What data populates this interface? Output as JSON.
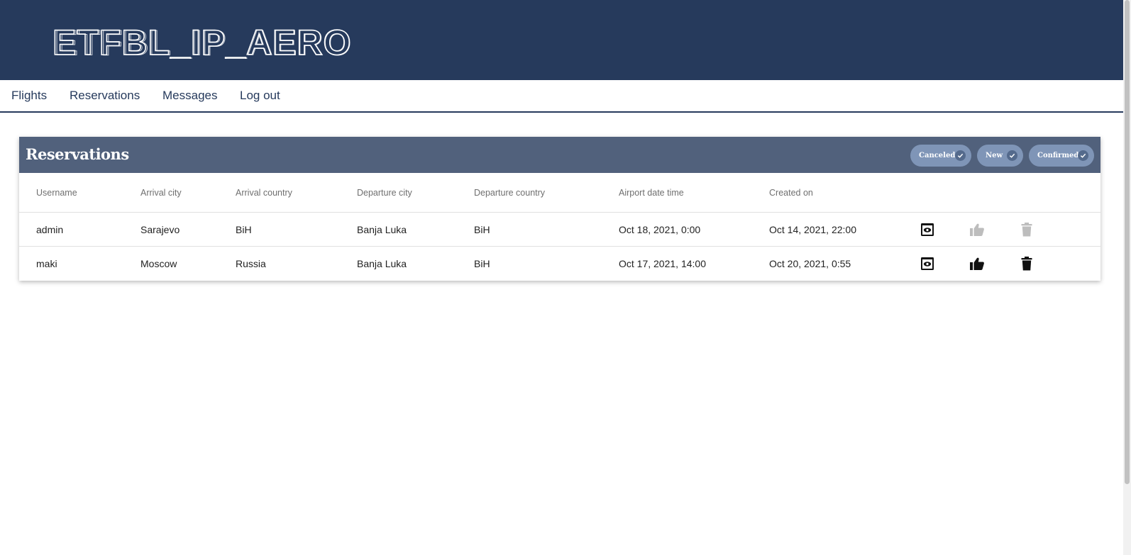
{
  "app": {
    "logo_text": "ETFBL_IP_AERO"
  },
  "nav": {
    "items": [
      {
        "label": "Flights"
      },
      {
        "label": "Reservations"
      },
      {
        "label": "Messages"
      },
      {
        "label": "Log out"
      }
    ]
  },
  "card": {
    "title": "Reservations",
    "filters": [
      {
        "label": "Canceled",
        "selected": true
      },
      {
        "label": "New",
        "selected": true
      },
      {
        "label": "Confirmed",
        "selected": true
      }
    ]
  },
  "table": {
    "columns": [
      "Username",
      "Arrival city",
      "Arrival country",
      "Departure city",
      "Departure country",
      "Airport date time",
      "Created on"
    ],
    "rows": [
      {
        "cells": [
          "admin",
          "Sarajevo",
          "BiH",
          "Banja Luka",
          "BiH",
          "Oct 18, 2021, 0:00",
          "Oct 14, 2021, 22:00"
        ],
        "actions": [
          {
            "icon": "view-icon",
            "enabled": true
          },
          {
            "icon": "thumb-up-icon",
            "enabled": false
          },
          {
            "icon": "trash-icon",
            "enabled": false
          }
        ]
      },
      {
        "cells": [
          "maki",
          "Moscow",
          "Russia",
          "Banja Luka",
          "BiH",
          "Oct 17, 2021, 14:00",
          "Oct 20, 2021, 0:55"
        ],
        "actions": [
          {
            "icon": "view-icon",
            "enabled": true
          },
          {
            "icon": "thumb-up-icon",
            "enabled": true
          },
          {
            "icon": "trash-icon",
            "enabled": true
          }
        ]
      }
    ]
  },
  "colors": {
    "header_bg": "#263a5c",
    "card_head_bg": "#51617c",
    "chip_bg": "#7f95b7",
    "disabled_icon": "#bdbdbd"
  }
}
